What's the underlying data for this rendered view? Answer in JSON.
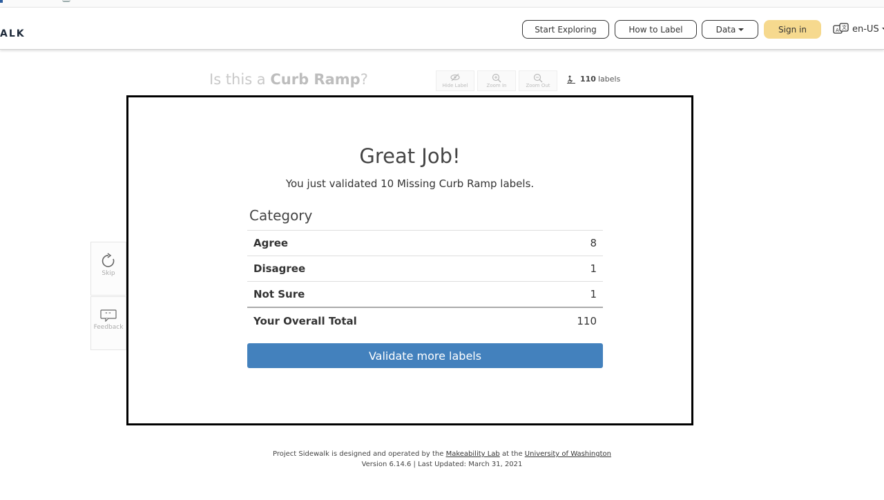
{
  "navbar": {
    "brand": "ALK",
    "buttons": {
      "start_exploring": "Start Exploring",
      "how_to_label": "How to Label",
      "data": "Data",
      "sign_in": "Sign in"
    },
    "language": "en-US"
  },
  "validate": {
    "question_prefix": "Is this a ",
    "question_label": "Curb Ramp",
    "question_suffix": "?",
    "tools": {
      "hide_label": "Hide Label",
      "zoom_in": "Zoom In",
      "zoom_out": "Zoom Out"
    },
    "label_count": "110",
    "label_count_unit": "labels",
    "side": {
      "skip": "Skip",
      "feedback": "Feedback"
    }
  },
  "modal": {
    "title": "Great Job!",
    "subtitle": "You just validated 10 Missing Curb Ramp labels.",
    "table_header": "Category",
    "rows": [
      {
        "label": "Agree",
        "value": "8"
      },
      {
        "label": "Disagree",
        "value": "1"
      },
      {
        "label": "Not Sure",
        "value": "1"
      }
    ],
    "total": {
      "label": "Your Overall Total",
      "value": "110"
    },
    "cta": "Validate more labels"
  },
  "footer": {
    "line1_prefix": "Project Sidewalk is designed and operated by the ",
    "lab_link": "Makeability Lab",
    "line1_mid": " at the ",
    "uw_link": "University of Washington",
    "line2": "Version 6.14.6 | Last Updated: March 31, 2021"
  },
  "colors": {
    "sign_in_bg": "#f6d98e",
    "cta_bg": "#4381bd"
  }
}
